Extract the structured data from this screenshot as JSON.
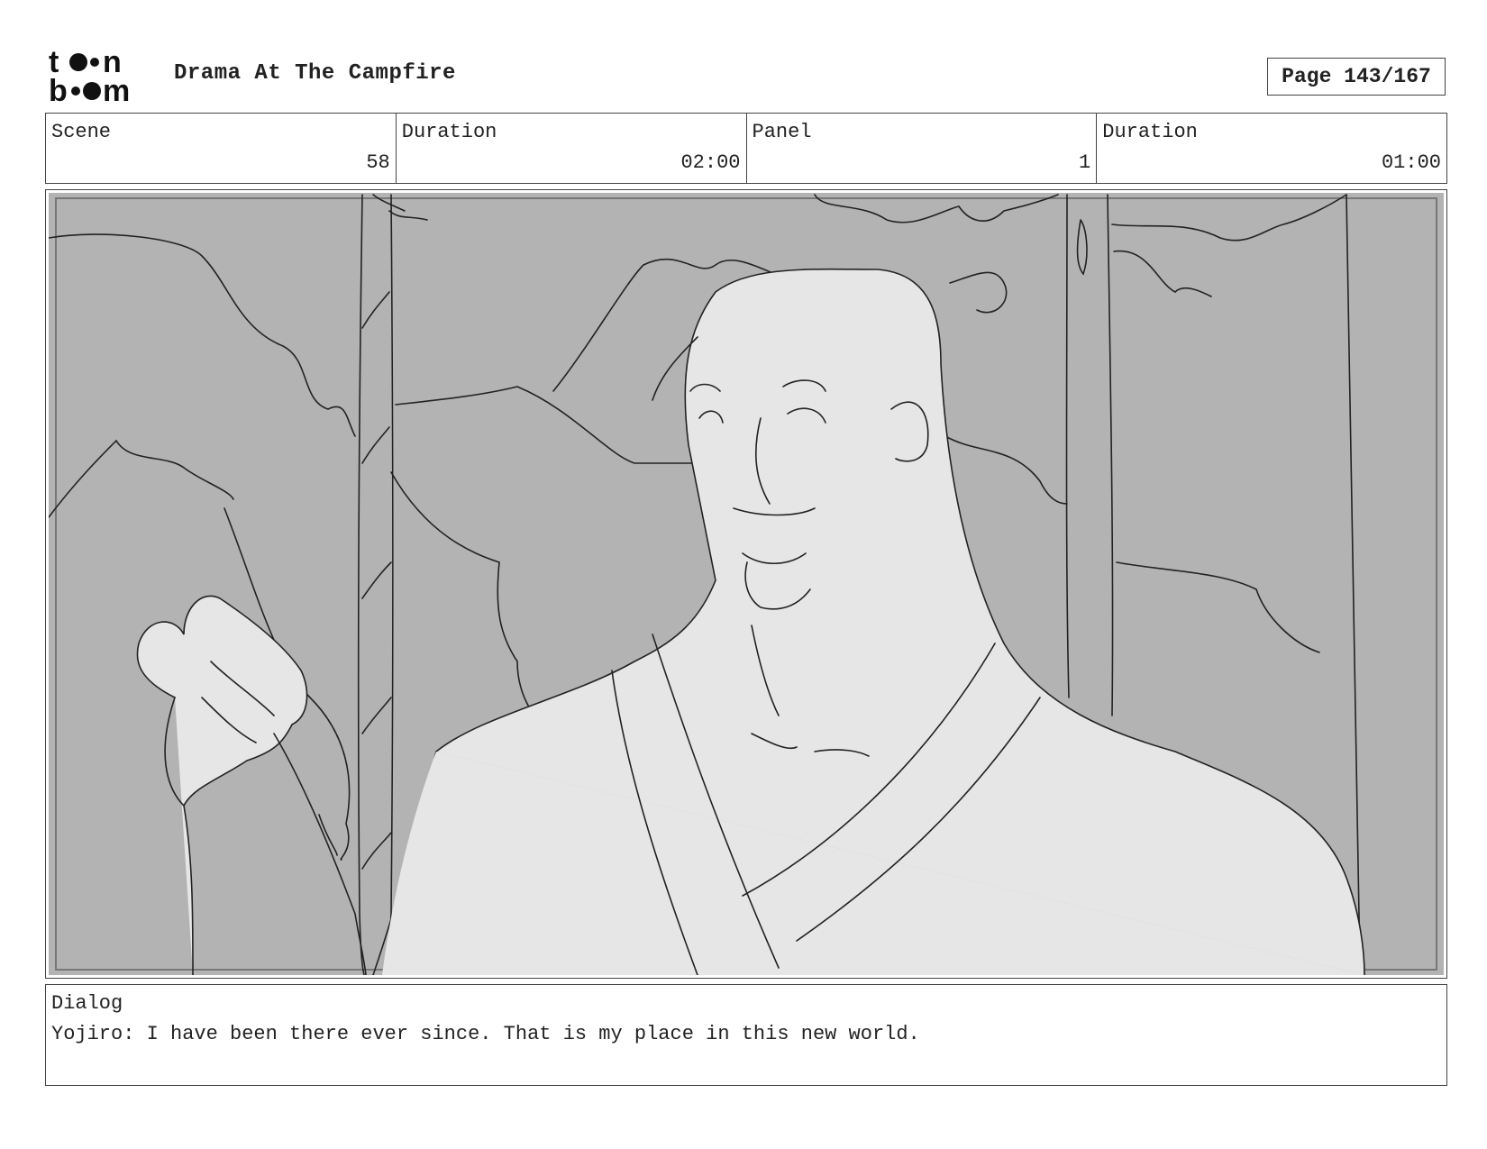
{
  "header": {
    "logo_text": [
      "to",
      "n",
      "b",
      "m"
    ],
    "title": "Drama At The Campfire",
    "page": "Page 143/167"
  },
  "info": {
    "scene_label": "Scene",
    "scene_value": "58",
    "scene_duration_label": "Duration",
    "scene_duration_value": "02:00",
    "panel_label": "Panel",
    "panel_value": "1",
    "panel_duration_label": "Duration",
    "panel_duration_value": "01:00"
  },
  "panel": {
    "image_description_icon": "storyboard-sketch"
  },
  "dialog": {
    "label": "Dialog",
    "text": "Yojiro: I have been there ever since. That is my place in this new world."
  },
  "colors": {
    "background_gray": "#b3b3b3",
    "figure_fill": "#e6e6e6",
    "line": "#222222"
  }
}
